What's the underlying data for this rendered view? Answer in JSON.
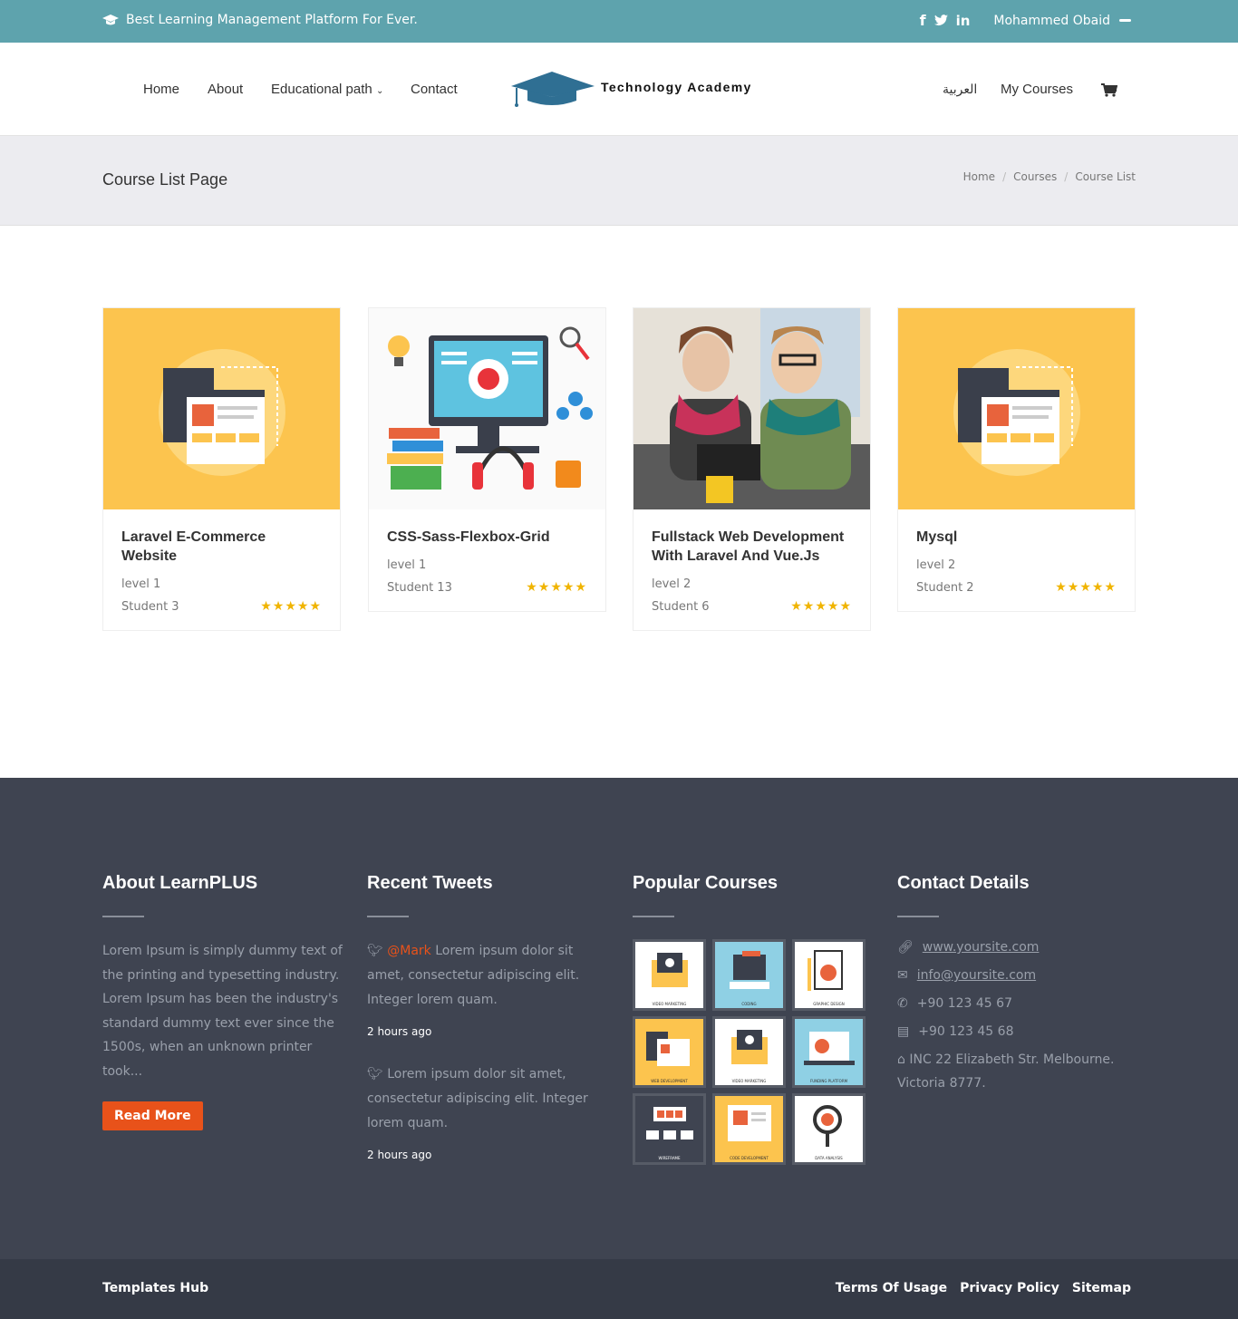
{
  "topbar": {
    "tagline": "Best Learning Management Platform For Ever.",
    "user": "Mohammed Obaid"
  },
  "nav": {
    "home": "Home",
    "about": "About",
    "edu": "Educational path",
    "contact": "Contact",
    "lang": "العربية",
    "mycourses": "My Courses"
  },
  "logo": {
    "text": "Technology Academy"
  },
  "page": {
    "title": "Course List Page",
    "crumbs": [
      "Home",
      "Courses",
      "Course List"
    ]
  },
  "courses": [
    {
      "title": "Laravel E-Commerce Website",
      "level": "level 1",
      "students": "Student 3",
      "rating": 5
    },
    {
      "title": "CSS-Sass-Flexbox-Grid",
      "level": "level 1",
      "students": "Student 13",
      "rating": 5
    },
    {
      "title": "Fullstack Web Development With Laravel And Vue.Js",
      "level": "level 2",
      "students": "Student 6",
      "rating": 5
    },
    {
      "title": "Mysql",
      "level": "level 2",
      "students": "Student 2",
      "rating": 5
    }
  ],
  "footer": {
    "about": {
      "title": "About LearnPLUS",
      "text": "Lorem Ipsum is simply dummy text of the printing and typesetting industry. Lorem Ipsum has been the industry's standard dummy text ever since the 1500s, when an unknown printer took...",
      "button": "Read More"
    },
    "tweets": {
      "title": "Recent Tweets",
      "items": [
        {
          "handle": "@Mark",
          "text": "Lorem ipsum dolor sit amet, consectetur adipiscing elit. Integer lorem quam.",
          "time": "2 hours ago"
        },
        {
          "handle": "",
          "text": "Lorem ipsum dolor sit amet, consectetur adipiscing elit. Integer lorem quam.",
          "time": "2 hours ago"
        }
      ]
    },
    "popular": {
      "title": "Popular Courses",
      "thumbs": [
        "VIDEO MARKETING",
        "CODING",
        "GRAPHIC DESIGN",
        "WEB DEVELOPMENT",
        "VIDEO MARKETING",
        "FUNDING PLATFORM",
        "WIREFRAME",
        "CODE DEVELOPMENT",
        "DATA ANALYSIS"
      ]
    },
    "contact": {
      "title": "Contact Details",
      "site": "www.yoursite.com",
      "email": "info@yoursite.com",
      "phone": "+90 123 45 67",
      "fax": "+90 123 45 68",
      "address": "INC 22 Elizabeth Str. Melbourne. Victoria 8777."
    }
  },
  "bottom": {
    "left": "Templates Hub",
    "links": [
      "Terms Of Usage",
      "Privacy Policy",
      "Sitemap"
    ]
  },
  "colors": {
    "topbar": "#5ea3ad",
    "accent": "#e8521a",
    "footer": "#3f4451",
    "star": "#f0b400"
  }
}
